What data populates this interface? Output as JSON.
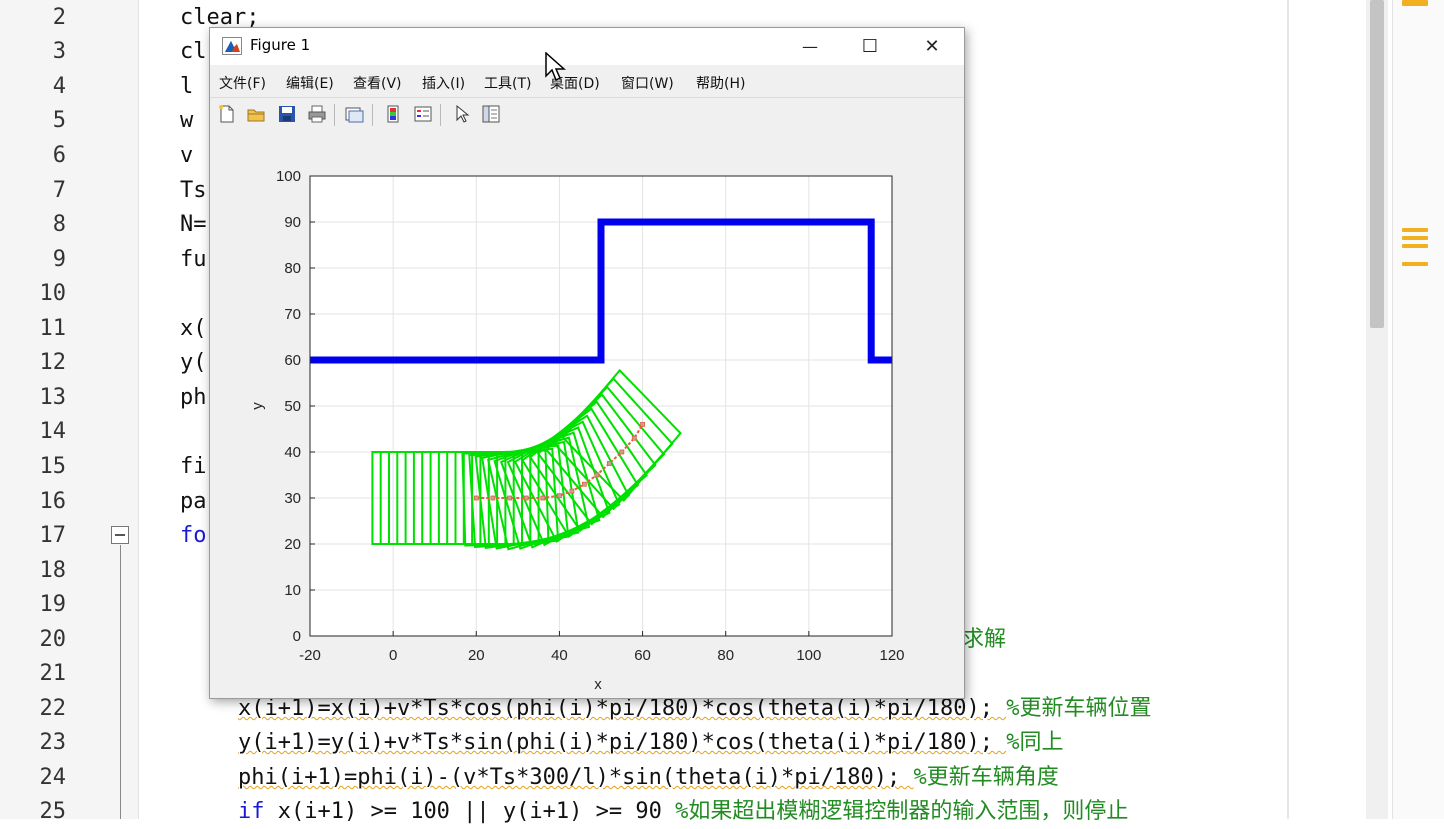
{
  "editor": {
    "lines": [
      {
        "num": "2",
        "text": "clear;"
      },
      {
        "num": "3",
        "text": "cl"
      },
      {
        "num": "4",
        "text": "l"
      },
      {
        "num": "5",
        "text": "w"
      },
      {
        "num": "6",
        "text": "v"
      },
      {
        "num": "7",
        "text": "Ts"
      },
      {
        "num": "8",
        "text": "N="
      },
      {
        "num": "9",
        "text": "fu"
      },
      {
        "num": "10",
        "text": ""
      },
      {
        "num": "11",
        "text": "x("
      },
      {
        "num": "12",
        "text": "y("
      },
      {
        "num": "13",
        "text": "ph"
      },
      {
        "num": "14",
        "text": ""
      },
      {
        "num": "15",
        "text": "fi"
      },
      {
        "num": "16",
        "text": "pa"
      },
      {
        "num": "17",
        "text": "fo"
      },
      {
        "num": "18",
        "text": ""
      },
      {
        "num": "19",
        "text": ""
      },
      {
        "num": "20",
        "text": "求解"
      },
      {
        "num": "21",
        "text": ""
      },
      {
        "num": "22",
        "code": "x(i+1)=x(i)+v*Ts*cos(phi(i)*pi/180)*cos(theta(i)*pi/180); ",
        "comment": "%更新车辆位置"
      },
      {
        "num": "23",
        "code": "y(i+1)=y(i)+v*Ts*sin(phi(i)*pi/180)*cos(theta(i)*pi/180); ",
        "comment": "%同上"
      },
      {
        "num": "24",
        "code": "phi(i+1)=phi(i)-(v*Ts*300/l)*sin(theta(i)*pi/180); ",
        "comment": "%更新车辆角度"
      },
      {
        "num": "25",
        "keyword": "if",
        "code": " x(i+1) >= 100 || y(i+1) >= 90 ",
        "comment": "%如果超出模糊逻辑控制器的输入范围，则停止"
      }
    ]
  },
  "figure": {
    "title": "Figure 1",
    "window_buttons": {
      "minimize": "—",
      "maximize": "☐",
      "close": "✕"
    },
    "menu": [
      "文件(F)",
      "编辑(E)",
      "查看(V)",
      "插入(I)",
      "工具(T)",
      "桌面(D)",
      "窗口(W)",
      "帮助(H)"
    ],
    "menu_corner": "↘",
    "toolbar": [
      "new-figure",
      "open-file",
      "save",
      "print",
      "link-plot",
      "insert-colorbar",
      "insert-legend",
      "edit-plot",
      "property-inspector"
    ]
  },
  "chart_data": {
    "type": "line",
    "xlabel": "x",
    "ylabel": "y",
    "xlim": [
      -20,
      120
    ],
    "ylim": [
      0,
      100
    ],
    "xticks": [
      -20,
      0,
      20,
      40,
      60,
      80,
      100,
      120
    ],
    "yticks": [
      0,
      10,
      20,
      30,
      40,
      50,
      60,
      70,
      80,
      90,
      100
    ],
    "grid": true,
    "colors": {
      "road": "#0000ee",
      "vehicle": "#00e000",
      "path": "#e06040"
    },
    "series": [
      {
        "role": "road-boundary",
        "x": [
          -20,
          50,
          50,
          115,
          115,
          120
        ],
        "y": [
          60,
          60,
          90,
          90,
          60,
          60
        ]
      },
      {
        "role": "vehicle-path",
        "x": [
          20,
          24,
          28,
          32,
          36,
          40,
          43,
          46,
          49,
          52,
          55,
          58,
          60
        ],
        "y": [
          30,
          30,
          30,
          30,
          30,
          30.5,
          31.5,
          33,
          35,
          37.5,
          40,
          43,
          46
        ]
      }
    ],
    "vehicle_poses": {
      "length": 20,
      "width": 20,
      "poses": [
        {
          "x": 5,
          "y": 30,
          "phi": 0
        },
        {
          "x": 7,
          "y": 30,
          "phi": 0
        },
        {
          "x": 9,
          "y": 30,
          "phi": 0
        },
        {
          "x": 11,
          "y": 30,
          "phi": 0
        },
        {
          "x": 13,
          "y": 30,
          "phi": 0
        },
        {
          "x": 15,
          "y": 30,
          "phi": 0
        },
        {
          "x": 17,
          "y": 30,
          "phi": 0
        },
        {
          "x": 19,
          "y": 30,
          "phi": 0
        },
        {
          "x": 21,
          "y": 30,
          "phi": 0
        },
        {
          "x": 23,
          "y": 30,
          "phi": 0
        },
        {
          "x": 25,
          "y": 30,
          "phi": 0
        },
        {
          "x": 27,
          "y": 30,
          "phi": 2
        },
        {
          "x": 29,
          "y": 30,
          "phi": 4
        },
        {
          "x": 31,
          "y": 30.3,
          "phi": 7
        },
        {
          "x": 33,
          "y": 30.6,
          "phi": 10
        },
        {
          "x": 35,
          "y": 31,
          "phi": 14
        },
        {
          "x": 37,
          "y": 31.6,
          "phi": 18
        },
        {
          "x": 39,
          "y": 32.3,
          "phi": 22
        },
        {
          "x": 41,
          "y": 33.2,
          "phi": 26
        },
        {
          "x": 43,
          "y": 34.2,
          "phi": 30
        },
        {
          "x": 45,
          "y": 35.5,
          "phi": 34
        },
        {
          "x": 47,
          "y": 36.9,
          "phi": 37
        },
        {
          "x": 49,
          "y": 38.4,
          "phi": 40
        },
        {
          "x": 51,
          "y": 40,
          "phi": 43
        },
        {
          "x": 53,
          "y": 41.8,
          "phi": 45
        },
        {
          "x": 55,
          "y": 43.6,
          "phi": 47
        }
      ]
    }
  }
}
